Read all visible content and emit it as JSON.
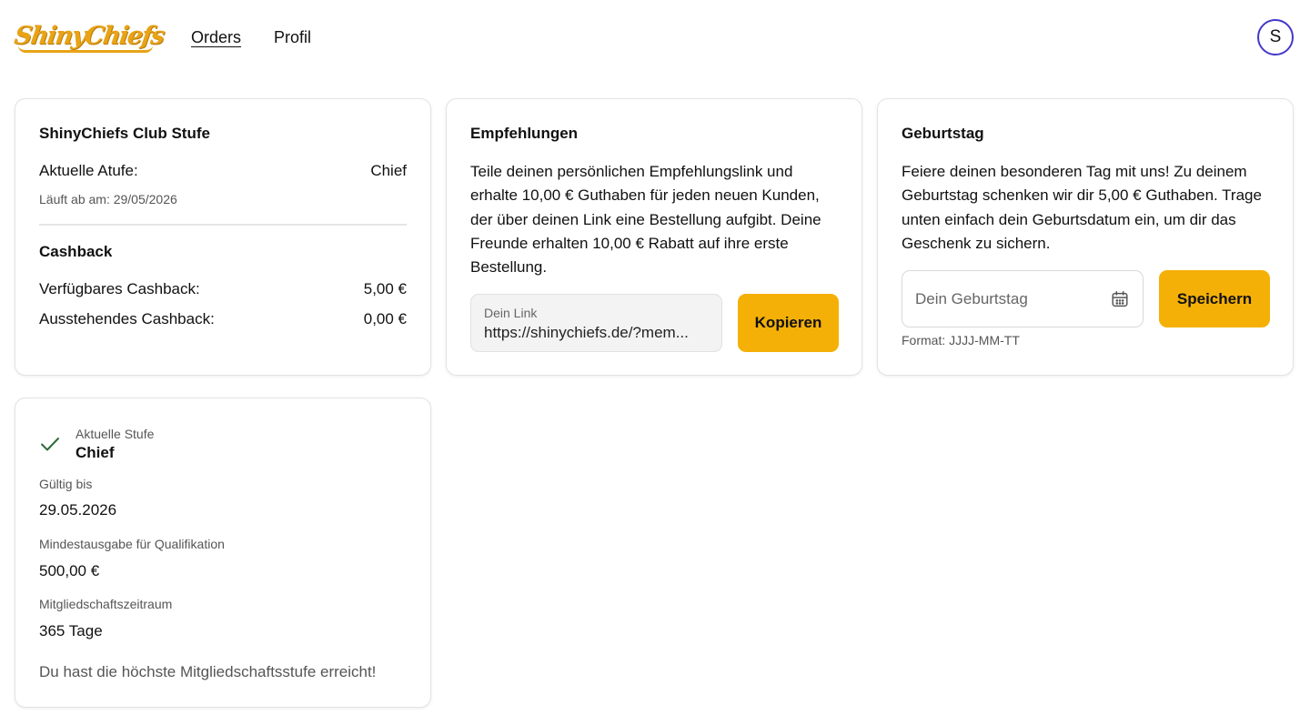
{
  "header": {
    "logo_text": "ShinyChiefs",
    "nav": [
      {
        "label": "Orders"
      },
      {
        "label": "Profil"
      }
    ],
    "avatar_initial": "S"
  },
  "club": {
    "title": "ShinyChiefs Club Stufe",
    "current_label": "Aktuelle Atufe:",
    "current_value": "Chief",
    "expires": "Läuft ab am: 29/05/2026",
    "cashback_title": "Cashback",
    "available_label": "Verfügbares Cashback:",
    "available_value": "5,00 €",
    "pending_label": "Ausstehendes Cashback:",
    "pending_value": "0,00 €"
  },
  "referral": {
    "title": "Empfehlungen",
    "text": "Teile deinen persönlichen Empfehlungslink und erhalte 10,00 € Guthaben für jeden neuen Kunden, der über deinen Link eine Bestellung aufgibt. Deine Freunde erhalten 10,00 € Rabatt auf ihre erste Bestellung.",
    "link_label": "Dein Link",
    "link_value": "https://shinychiefs.de/?mem...",
    "copy_button": "Kopieren"
  },
  "birthday": {
    "title": "Geburtstag",
    "text": "Feiere deinen besonderen Tag mit uns! Zu deinem Geburtstag schenken wir dir 5,00 € Guthaben. Trage unten einfach dein Geburtsdatum ein, um dir das Geschenk zu sichern.",
    "placeholder": "Dein Geburtstag",
    "save_button": "Speichern",
    "format_hint": "Format: JJJJ-MM-TT"
  },
  "tier": {
    "current_label": "Aktuelle Stufe",
    "current_value": "Chief",
    "valid_label": "Gültig bis",
    "valid_value": "29.05.2026",
    "min_label": "Mindestausgabe für Qualifikation",
    "min_value": "500,00 €",
    "period_label": "Mitgliedschaftszeitraum",
    "period_value": "365 Tage",
    "note": "Du hast die höchste Mitgliedschaftsstufe erreicht!"
  },
  "colors": {
    "accent": "#f5b008",
    "logo": "#e8a317",
    "avatar_border": "#4338ca",
    "check": "#2f6b3a"
  }
}
